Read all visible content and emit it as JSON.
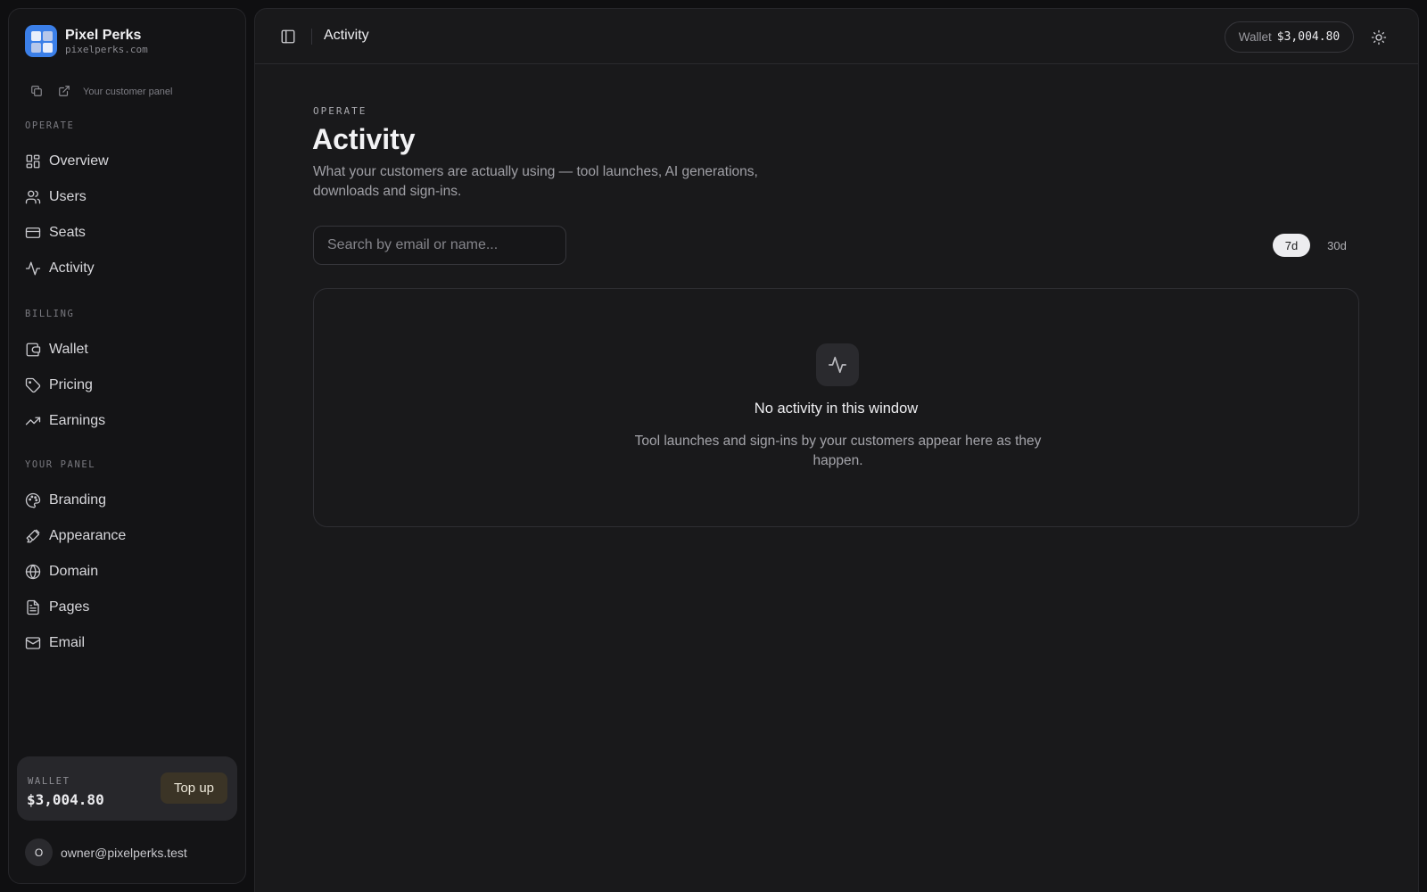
{
  "brand": {
    "name": "Pixel Perks",
    "domain": "pixelperks.com"
  },
  "sidebar": {
    "panel_link": "Your customer panel",
    "sections": [
      {
        "label": "OPERATE",
        "items": [
          {
            "label": "Overview",
            "icon": "grid-icon"
          },
          {
            "label": "Users",
            "icon": "users-icon"
          },
          {
            "label": "Seats",
            "icon": "card-icon"
          },
          {
            "label": "Activity",
            "icon": "activity-icon"
          }
        ]
      },
      {
        "label": "BILLING",
        "items": [
          {
            "label": "Wallet",
            "icon": "wallet-icon"
          },
          {
            "label": "Pricing",
            "icon": "tag-icon"
          },
          {
            "label": "Earnings",
            "icon": "trending-up-icon"
          }
        ]
      },
      {
        "label": "YOUR PANEL",
        "items": [
          {
            "label": "Branding",
            "icon": "palette-icon"
          },
          {
            "label": "Appearance",
            "icon": "brush-icon"
          },
          {
            "label": "Domain",
            "icon": "globe-icon"
          },
          {
            "label": "Pages",
            "icon": "file-icon"
          },
          {
            "label": "Email",
            "icon": "mail-icon"
          }
        ]
      }
    ],
    "wallet_label": "WALLET",
    "wallet_value": "$3,004.80",
    "topup_label": "Top up",
    "user_initial": "O",
    "user_email": "owner@pixelperks.test"
  },
  "header": {
    "title": "Activity",
    "wallet_label": "Wallet",
    "wallet_value": "$3,004.80"
  },
  "main": {
    "eyebrow": "OPERATE",
    "title": "Activity",
    "description": "What your customers are actually using — tool launches, AI generations, downloads and sign-ins.",
    "search_placeholder": "Search by email or name...",
    "ranges": [
      "7d",
      "30d"
    ],
    "selected_range": "7d",
    "empty_title": "No activity in this window",
    "empty_desc": "Tool launches and sign-ins by your customers appear here as they happen."
  }
}
